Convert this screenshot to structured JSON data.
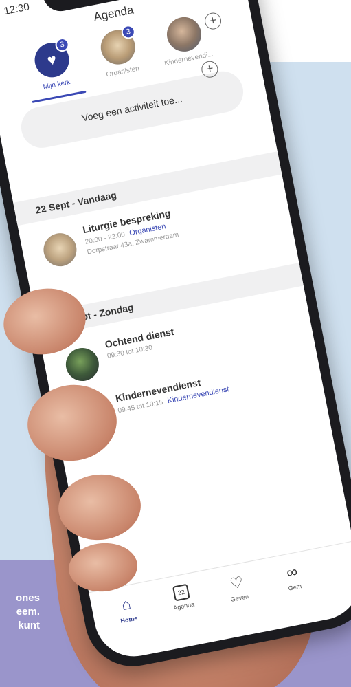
{
  "cta": {
    "line1": "ones",
    "line2": "eem.",
    "line3": "kunt"
  },
  "status": {
    "time": "12:30"
  },
  "app": {
    "title": "Agenda"
  },
  "groups": [
    {
      "label": "Mijn kerk",
      "badge": "3"
    },
    {
      "label": "Organisten",
      "badge": "3"
    },
    {
      "label": "Kindernevendi..."
    }
  ],
  "add_activity": {
    "label": "Voeg een activiteit toe..."
  },
  "sections": [
    {
      "header": "22 Sept - Vandaag",
      "events": [
        {
          "title": "Liturgie bespreking",
          "time": "20:00 - 22:00",
          "tag": "Organisten",
          "location": "Dorpstraat 43a, Zwammerdam"
        }
      ]
    },
    {
      "header": "24 Sept - Zondag",
      "events": [
        {
          "title": "Ochtend dienst",
          "time": "09:30 tot 10:30"
        },
        {
          "title": "Kindernevendienst",
          "time": "09:45 tot 10:15",
          "tag": "Kindernevendienst"
        }
      ]
    }
  ],
  "bottom_nav": {
    "items": [
      {
        "label": "Home",
        "icon": "home-icon"
      },
      {
        "label": "Agenda",
        "icon": "calendar-icon",
        "day": "22"
      },
      {
        "label": "Geven",
        "icon": "giving-icon"
      },
      {
        "label": "Gem",
        "icon": "community-icon"
      }
    ]
  },
  "colors": {
    "brand": "#3b49b5",
    "brand_dark": "#2d3a8c",
    "bg_blue": "#cfe0ef",
    "bg_purple": "#9a95cb"
  }
}
